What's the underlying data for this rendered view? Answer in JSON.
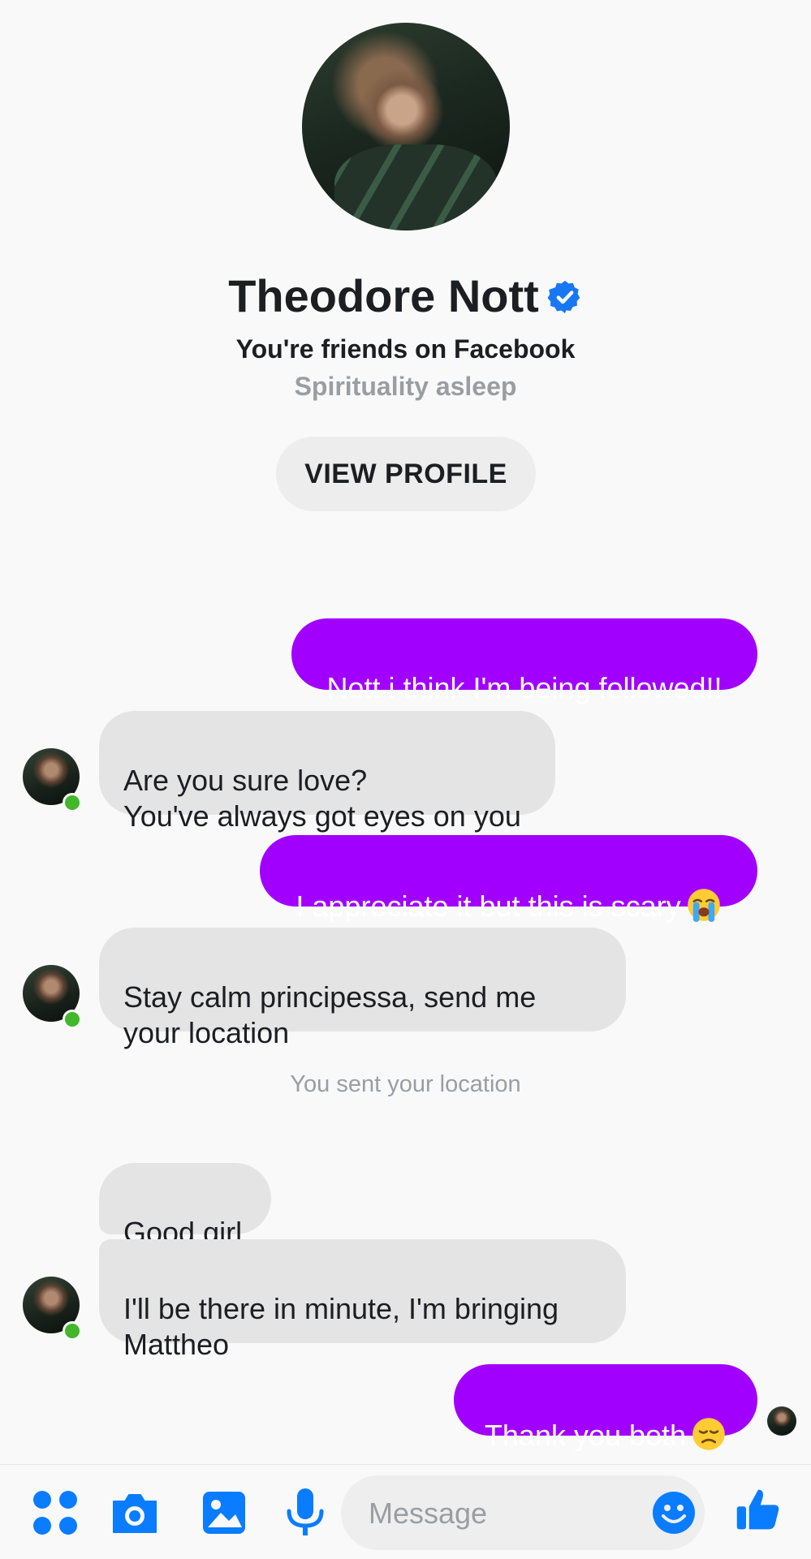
{
  "header": {
    "name": "Theodore Nott",
    "friends_text": "You're friends on Facebook",
    "subtitle": "Spirituality asleep",
    "view_profile_label": "VIEW PROFILE"
  },
  "messages": [
    {
      "direction": "out",
      "text": "Nott i think I'm being followed!!"
    },
    {
      "direction": "in",
      "text": "Are you sure love?\nYou've always got eyes on you"
    },
    {
      "direction": "out",
      "text": "I appreciate it but this is scary",
      "emoji": "loudly-crying-face"
    },
    {
      "direction": "in",
      "text": "Stay calm principessa, send me\nyour location"
    },
    {
      "direction": "in",
      "text": "Good girl"
    },
    {
      "direction": "in",
      "text": "I'll be there in minute, I'm bringing\nMattheo"
    },
    {
      "direction": "out",
      "text": "Thank you both",
      "emoji": "disappointed-face"
    }
  ],
  "system_message": "You sent your location",
  "composer": {
    "placeholder": "Message"
  },
  "colors": {
    "outgoing_bubble": "#a100ff",
    "incoming_bubble": "#e4e4e5",
    "accent": "#0a7cff",
    "online": "#42b72a"
  },
  "icons": [
    "apps-icon",
    "camera-icon",
    "gallery-icon",
    "microphone-icon",
    "emoji-icon",
    "thumbs-up-icon",
    "verified-badge-icon"
  ]
}
